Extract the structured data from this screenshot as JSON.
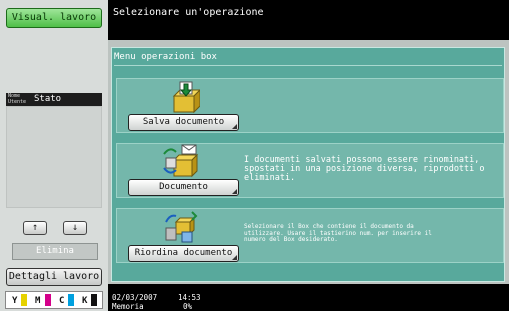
{
  "left_panel": {
    "visual_button": "Visual. lavoro",
    "user_label_line1": "Nome",
    "user_label_line2": "Utente",
    "status_label": "Stato",
    "up_icon": "arrow-up",
    "down_icon": "arrow-down",
    "delete_button": "Elimina",
    "details_button": "Dettagli lavoro",
    "toner": [
      {
        "letter": "Y",
        "color": "#e6d200"
      },
      {
        "letter": "M",
        "color": "#d4008a"
      },
      {
        "letter": "C",
        "color": "#00a0df"
      },
      {
        "letter": "K",
        "color": "#111111"
      }
    ]
  },
  "top_message": "Selezionare un'operazione",
  "main": {
    "title": "Menu operazioni box",
    "operations": [
      {
        "label": "Salva documento",
        "icon": "save-box-icon",
        "description": ""
      },
      {
        "label": "Documento",
        "icon": "document-box-icon",
        "description": "I documenti salvati possono essere rinominati, spostati in una posizione diversa, riprodotti o eliminati."
      },
      {
        "label": "Riordina documento",
        "icon": "reorganize-box-icon",
        "description": "Selezionare il Box che contiene il documento da utilizzare. Usare il tastierino num. per inserire il numero del Box desiderato."
      }
    ]
  },
  "status_bar": {
    "date": "02/03/2007",
    "time": "14:53",
    "memory_label": "Memoria",
    "memory_value": "0%"
  }
}
